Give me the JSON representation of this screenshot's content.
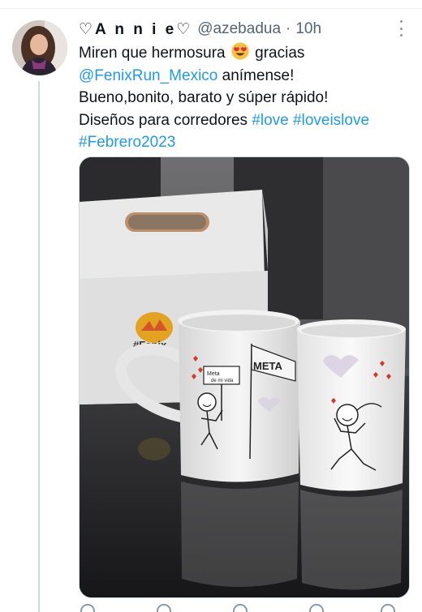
{
  "tweet": {
    "display_name": "♡A n n i e♡",
    "handle": "@azebadua",
    "separator": "·",
    "time": "10h",
    "text": {
      "line1_before": "Miren que hermosura",
      "line1_emoji": "smiling-face-with-heart-eyes",
      "line1_after": "gracias",
      "mention": "@FenixRun_Mexico",
      "line2_after": " anímense!",
      "line3": "Bueno,bonito, barato y súper rápido!",
      "line4_before": "Diseños para corredores ",
      "hashtag1": "#love",
      "hashtag2": "#loveislove",
      "hashtag3": "#Febrero2023"
    },
    "link_color": "#1d9bf0",
    "media": {
      "box_logo_text": "#Fenix",
      "sign_text": "Meta",
      "sign_text_2": "de mi vida",
      "finish_banner": "META"
    }
  }
}
